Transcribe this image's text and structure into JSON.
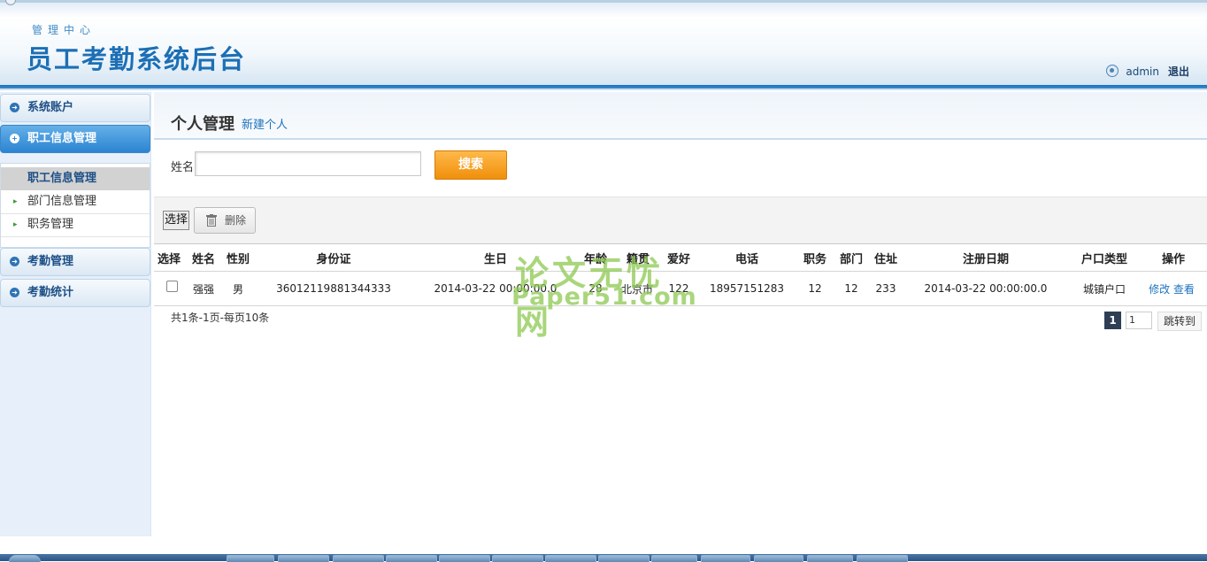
{
  "header": {
    "subtitle": "管理中心",
    "title": "员工考勤系统后台",
    "username": "admin",
    "logout": "退出"
  },
  "sidebar": {
    "items": [
      {
        "label": "系统账户"
      },
      {
        "label": "职工信息管理"
      },
      {
        "label": "考勤管理"
      },
      {
        "label": "考勤统计"
      }
    ],
    "submenu": {
      "active": "职工信息管理",
      "items": [
        {
          "label": "部门信息管理"
        },
        {
          "label": "职务管理"
        }
      ]
    }
  },
  "page": {
    "title": "个人管理",
    "new_link": "新建个人"
  },
  "search": {
    "label": "姓名",
    "value": "",
    "button": "搜索"
  },
  "toolbar": {
    "select": "选择",
    "delete": "删除"
  },
  "table": {
    "headers": {
      "select": "选择",
      "name": "姓名",
      "gender": "性别",
      "id_card": "身份证",
      "birthday": "生日",
      "age": "年龄",
      "origin": "籍贯",
      "hobby": "爱好",
      "phone": "电话",
      "position": "职务",
      "department": "部门",
      "address": "住址",
      "register_date": "注册日期",
      "household": "户口类型",
      "action": "操作"
    },
    "rows": [
      {
        "name": "强强",
        "gender": "男",
        "id_card": "36012119881344333",
        "birthday": "2014-03-22 00:00:00.0",
        "age": "28",
        "origin": "北京市",
        "hobby": "122",
        "phone": "18957151283",
        "position": "12",
        "department": "12",
        "address": "233",
        "register_date": "2014-03-22 00:00:00.0",
        "household": "城镇户口",
        "edit": "修改",
        "view": "查看"
      }
    ]
  },
  "pagination": {
    "summary": "共1条-1页-每页10条",
    "current": "1",
    "input_value": "1",
    "goto": "跳转到"
  },
  "watermark": {
    "line1": "论文无忧网",
    "line2": "Paper51.com"
  },
  "colors": {
    "brand_blue": "#1c6fb5",
    "active_menu": "#2b84d2",
    "search_button": "#f08f0b",
    "link": "#1e73be"
  }
}
